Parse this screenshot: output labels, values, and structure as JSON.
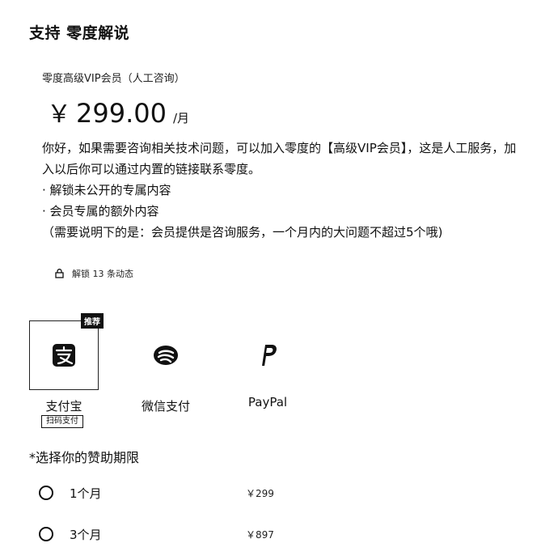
{
  "header": {
    "title": "支持 零度解说"
  },
  "plan": {
    "name": "零度高级VIP会员（人工咨询）",
    "currency": "￥",
    "price": "299.00",
    "unit": "/月",
    "description": [
      "你好，如果需要咨询相关技术问题，可以加入零度的【高级VIP会员】，这是人工服务，加入以后你可以通过内置的链接联系零度。",
      "· 解锁未公开的专属内容",
      "· 会员专属的额外内容",
      "（需要说明下的是：会员提供是咨询服务，一个月内的大问题不超过5个哦)"
    ],
    "unlock_text": "解锁 13 条动态"
  },
  "payment": {
    "recommended_badge": "推荐",
    "quick_badge": "扫码支付",
    "methods": [
      {
        "label": "支付宝",
        "icon": "alipay-icon"
      },
      {
        "label": "微信支付",
        "icon": "wechat-pay-icon"
      },
      {
        "label": "PayPal",
        "icon": "paypal-icon"
      }
    ]
  },
  "period": {
    "title": "*选择你的赞助期限",
    "options": [
      {
        "label": "1个月",
        "price": "￥299"
      },
      {
        "label": "3个月",
        "price": "￥897"
      }
    ]
  }
}
